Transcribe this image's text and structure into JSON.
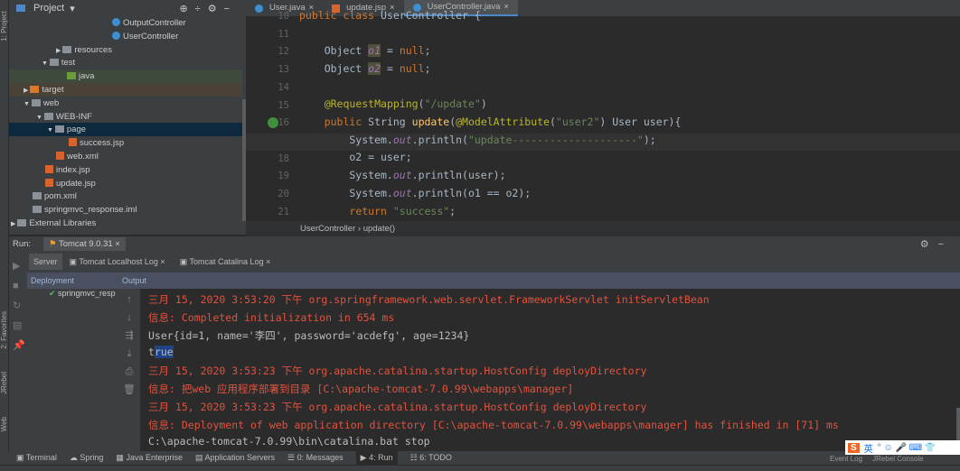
{
  "left_strip": {
    "project": "1: Project",
    "favorites": "2: Favorites",
    "jrebel": "JRebel",
    "web": "Web"
  },
  "project": {
    "title": "Project",
    "tree": [
      {
        "label": "OutputController",
        "icon": "class",
        "indent": 114
      },
      {
        "label": "UserController",
        "icon": "class",
        "indent": 114
      },
      {
        "label": "resources",
        "icon": "folder",
        "indent": 52,
        "arrow": "▶"
      },
      {
        "label": "test",
        "icon": "folder",
        "indent": 36,
        "arrow": "▼"
      },
      {
        "label": "java",
        "icon": "folder-green",
        "indent": 64
      },
      {
        "label": "target",
        "icon": "folder-orange",
        "indent": 16,
        "arrow": "▶"
      },
      {
        "label": "web",
        "icon": "folder",
        "indent": 16,
        "arrow": "▼"
      },
      {
        "label": "WEB-INF",
        "icon": "folder",
        "indent": 30,
        "arrow": "▼"
      },
      {
        "label": "page",
        "icon": "folder",
        "indent": 42,
        "arrow": "▼"
      },
      {
        "label": "success.jsp",
        "icon": "jsp",
        "indent": 66
      },
      {
        "label": "web.xml",
        "icon": "xml",
        "indent": 52
      },
      {
        "label": "index.jsp",
        "icon": "jsp",
        "indent": 40
      },
      {
        "label": "update.jsp",
        "icon": "jsp",
        "indent": 40
      },
      {
        "label": "pom.xml",
        "icon": "maven",
        "indent": 26
      },
      {
        "label": "springmvc_response.iml",
        "icon": "iml",
        "indent": 26
      },
      {
        "label": "External Libraries",
        "icon": "library",
        "indent": 2,
        "arrow": "▶"
      }
    ]
  },
  "editor": {
    "tabs": [
      "User.java",
      "update.jsp",
      "UserController.java"
    ],
    "active_tab": 2,
    "line_numbers": [
      "10",
      "11",
      "12",
      "13",
      "14",
      "15",
      "16",
      "17",
      "18",
      "19",
      "20",
      "21"
    ],
    "breadcrumb": [
      "UserController",
      "update()"
    ]
  },
  "run": {
    "label": "Run:",
    "config": "Tomcat 9.0.31",
    "tabs": [
      "Server",
      "Tomcat Localhost Log",
      "Tomcat Catalina Log"
    ],
    "deployment_header": "Deployment",
    "output_header": "Output",
    "deployment_item": "springmvc_resp",
    "output": [
      {
        "text": "三月 15, 2020 3:53:20 下午 org.springframework.web.servlet.FrameworkServlet initServletBean",
        "color": "red"
      },
      {
        "text": "信息: Completed initialization in 654 ms",
        "color": "red"
      },
      {
        "text": "User{id=1, name='李四', password='acdefg', age=1234}",
        "color": "white"
      },
      {
        "text": "true",
        "color": "white"
      },
      {
        "text": "三月 15, 2020 3:53:23 下午 org.apache.catalina.startup.HostConfig deployDirectory",
        "color": "red"
      },
      {
        "text": "信息: 把web 应用程序部署到目录 [C:\\apache-tomcat-7.0.99\\webapps\\manager]",
        "color": "red"
      },
      {
        "text": "三月 15, 2020 3:53:23 下午 org.apache.catalina.startup.HostConfig deployDirectory",
        "color": "red"
      },
      {
        "text": "信息: Deployment of web application directory [C:\\apache-tomcat-7.0.99\\webapps\\manager] has finished in [71] ms",
        "color": "red"
      },
      {
        "text": "C:\\apache-tomcat-7.0.99\\bin\\catalina.bat stop",
        "color": "white"
      }
    ]
  },
  "bottom_tools": [
    "Terminal",
    "Spring",
    "Java Enterprise",
    "Application Servers",
    "0: Messages",
    "4: Run",
    "6: TODO"
  ],
  "right_tools": [
    "Event Log",
    "JRebel Console"
  ],
  "ime": "英",
  "colors": {
    "error": "#e0533f",
    "keyword": "#cc7832",
    "string": "#6a8759",
    "annotation": "#bbb529",
    "selection": "#214283"
  }
}
